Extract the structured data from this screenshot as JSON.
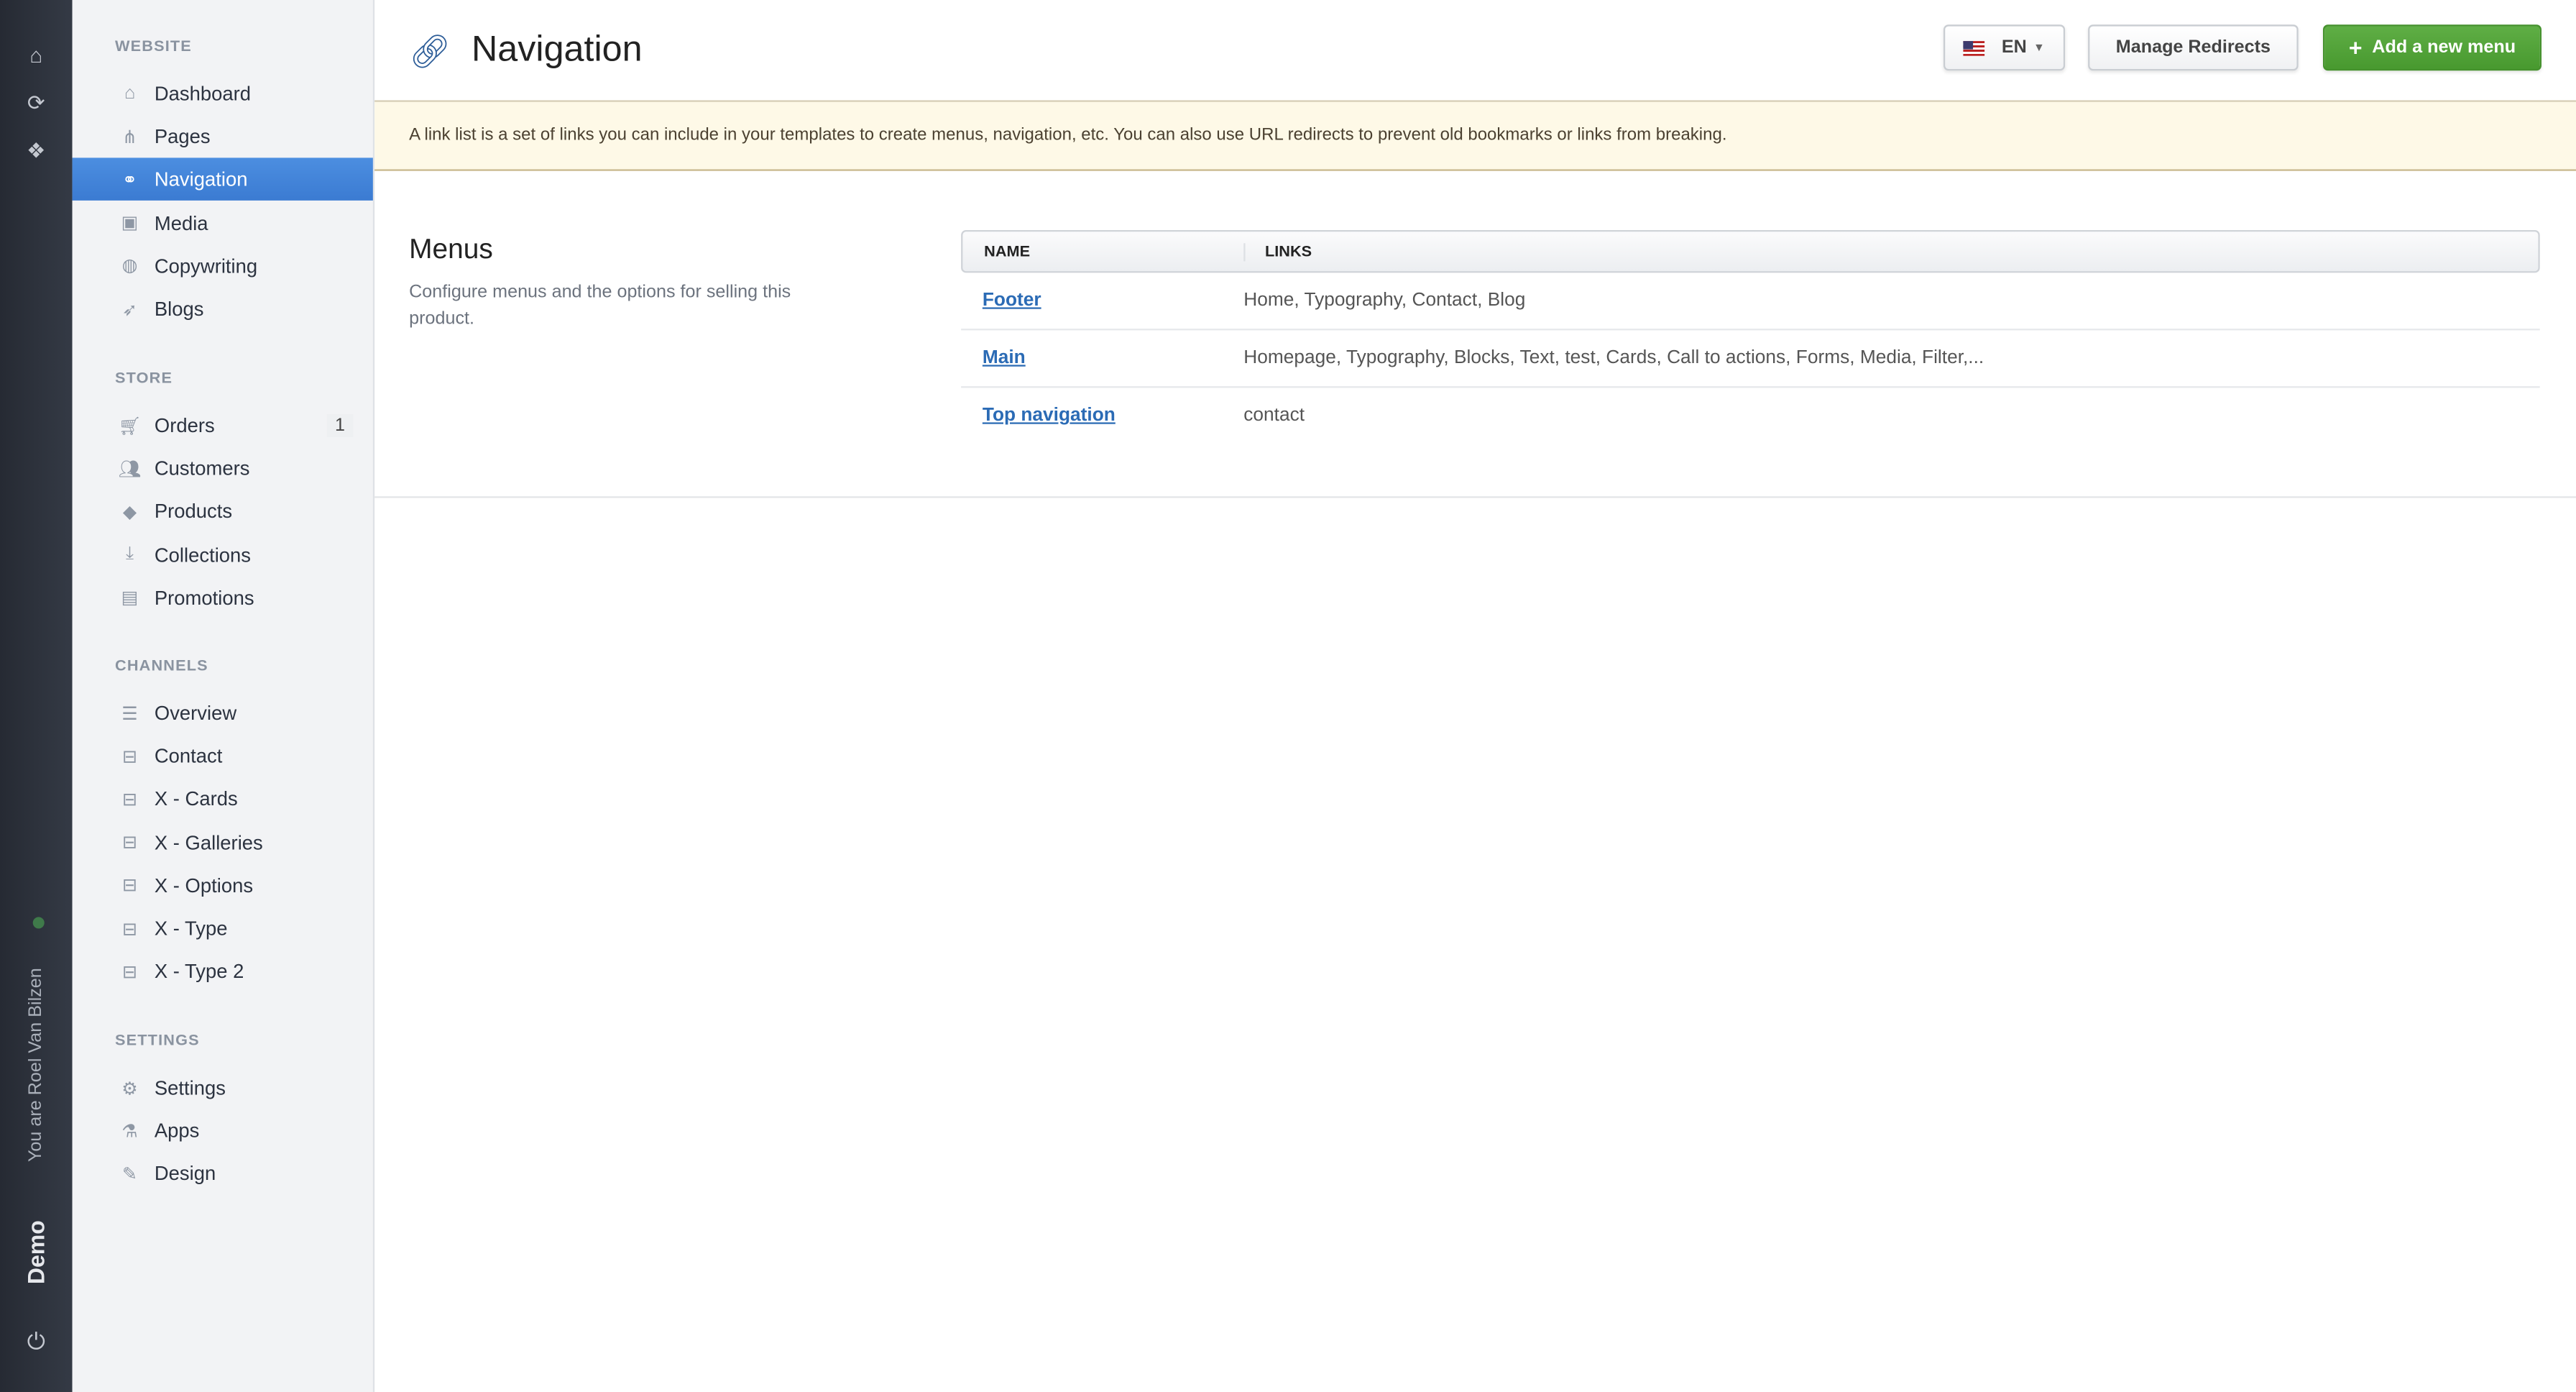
{
  "rail": {
    "user_text": "You are Roel Van Bilzen",
    "store_name": "Demo"
  },
  "sidebar": {
    "sections": [
      {
        "title": "WEBSITE",
        "items": [
          {
            "label": "Dashboard",
            "icon": "home-icon"
          },
          {
            "label": "Pages",
            "icon": "sitemap-icon"
          },
          {
            "label": "Navigation",
            "icon": "link-icon",
            "active": true
          },
          {
            "label": "Media",
            "icon": "images-icon"
          },
          {
            "label": "Copywriting",
            "icon": "globe-icon"
          },
          {
            "label": "Blogs",
            "icon": "feather-icon"
          }
        ]
      },
      {
        "title": "STORE",
        "items": [
          {
            "label": "Orders",
            "icon": "cart-icon",
            "badge": "1"
          },
          {
            "label": "Customers",
            "icon": "users-icon"
          },
          {
            "label": "Products",
            "icon": "tags-icon"
          },
          {
            "label": "Collections",
            "icon": "download-icon"
          },
          {
            "label": "Promotions",
            "icon": "gift-icon"
          }
        ]
      },
      {
        "title": "CHANNELS",
        "items": [
          {
            "label": "Overview",
            "icon": "database-icon"
          },
          {
            "label": "Contact",
            "icon": "channel-icon"
          },
          {
            "label": "X - Cards",
            "icon": "channel-icon"
          },
          {
            "label": "X - Galleries",
            "icon": "channel-icon"
          },
          {
            "label": "X - Options",
            "icon": "channel-icon"
          },
          {
            "label": "X - Type",
            "icon": "channel-icon"
          },
          {
            "label": "X - Type 2",
            "icon": "channel-icon"
          }
        ]
      },
      {
        "title": "SETTINGS",
        "items": [
          {
            "label": "Settings",
            "icon": "gear-icon"
          },
          {
            "label": "Apps",
            "icon": "flask-icon"
          },
          {
            "label": "Design",
            "icon": "magic-icon"
          }
        ]
      }
    ]
  },
  "header": {
    "title": "Navigation",
    "language": "EN",
    "manage_redirects": "Manage Redirects",
    "add_menu": "Add a new menu"
  },
  "alert": "A link list is a set of links you can include in your templates to create menus, navigation, etc. You can also use URL redirects to prevent old bookmarks or links from breaking.",
  "menus": {
    "title": "Menus",
    "description": "Configure menus and the options for selling this product.",
    "columns": [
      "NAME",
      "LINKS"
    ],
    "rows": [
      {
        "name": "Footer",
        "links": "Home, Typography, Contact, Blog"
      },
      {
        "name": "Main",
        "links": "Homepage, Typography, Blocks, Text, test, Cards, Call to actions, Forms, Media, Filter,..."
      },
      {
        "name": "Top navigation",
        "links": "contact"
      }
    ]
  }
}
